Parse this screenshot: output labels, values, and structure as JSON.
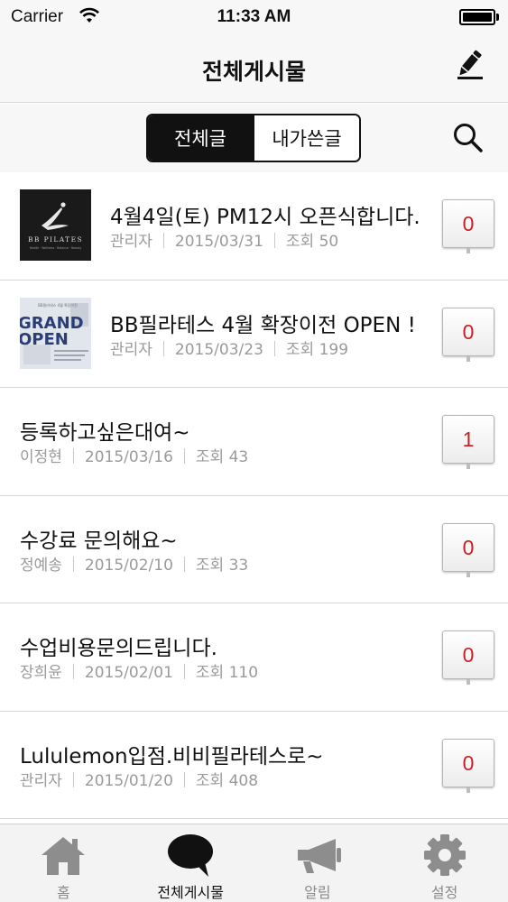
{
  "status_bar": {
    "carrier": "Carrier",
    "time": "11:33 AM"
  },
  "nav": {
    "title": "전체게시물",
    "compose_icon": "pencil-icon"
  },
  "segments": {
    "all": "전체글",
    "mine": "내가쓴글",
    "selected": "전체글",
    "search_icon": "search-icon"
  },
  "thumbnails": {
    "bb_pilates": {
      "logo_text": "BB PILATES",
      "tagline": "Health · Wellness · Balance · Beauty"
    },
    "grand_open": {
      "top_text": "BB필라테스 4월 확장이전",
      "line1": "GRAND",
      "line2": "OPEN"
    }
  },
  "posts": [
    {
      "title": "4월4일(토) PM12시 오픈식합니다.",
      "author": "관리자",
      "date": "2015/03/31",
      "views": "조회 50",
      "count": "0",
      "thumb": "bb_pilates"
    },
    {
      "title": "BB필라테스 4월 확장이전 OPEN !",
      "author": "관리자",
      "date": "2015/03/23",
      "views": "조회 199",
      "count": "0",
      "thumb": "grand_open"
    },
    {
      "title": "등록하고싶은대여~",
      "author": "이정현",
      "date": "2015/03/16",
      "views": "조회 43",
      "count": "1"
    },
    {
      "title": "수강료 문의해요~",
      "author": "정예송",
      "date": "2015/02/10",
      "views": "조회 33",
      "count": "0"
    },
    {
      "title": "수업비용문의드립니다.",
      "author": "장희윤",
      "date": "2015/02/01",
      "views": "조회 110",
      "count": "0"
    },
    {
      "title": "Lululemon입점.비비필라테스로~",
      "author": "관리자",
      "date": "2015/01/20",
      "views": "조회 408",
      "count": "0"
    }
  ],
  "tabs": [
    {
      "label": "홈",
      "icon": "home-icon",
      "active": false
    },
    {
      "label": "전체게시물",
      "icon": "speech-bubble-icon",
      "active": true
    },
    {
      "label": "알림",
      "icon": "megaphone-icon",
      "active": false
    },
    {
      "label": "설정",
      "icon": "gear-icon",
      "active": false
    }
  ],
  "colors": {
    "count_red": "#cc1f25",
    "meta_gray": "#9a9a9a",
    "bar_bg": "#f7f7f7"
  }
}
